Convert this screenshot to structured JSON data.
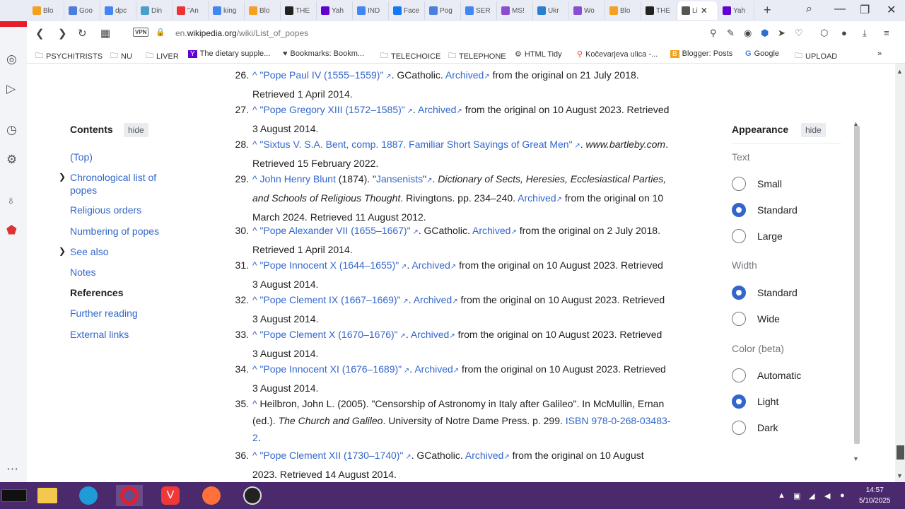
{
  "browser": {
    "tabs": [
      {
        "label": "Blo",
        "color": "#f4a020"
      },
      {
        "label": "Goo",
        "color": "#4a7fe0"
      },
      {
        "label": "dpc",
        "color": "#4285f4"
      },
      {
        "label": "Din",
        "color": "#4a9fd0"
      },
      {
        "label": "\"An",
        "color": "#e33"
      },
      {
        "label": "king",
        "color": "#4285f4"
      },
      {
        "label": "Blo",
        "color": "#f4a020"
      },
      {
        "label": "THE",
        "color": "#222"
      },
      {
        "label": "Yah",
        "color": "#6001d2"
      },
      {
        "label": "IND",
        "color": "#4285f4"
      },
      {
        "label": "Face",
        "color": "#1877f2"
      },
      {
        "label": "Pog",
        "color": "#4a7fe0"
      },
      {
        "label": "SER",
        "color": "#4285f4"
      },
      {
        "label": "MS!",
        "color": "#8a4fd0"
      },
      {
        "label": "Ukr",
        "color": "#2a7fd0"
      },
      {
        "label": "Wo",
        "color": "#8a4fd0"
      },
      {
        "label": "Blo",
        "color": "#f4a020"
      },
      {
        "label": "THE",
        "color": "#222"
      },
      {
        "label": "Li",
        "color": "#555",
        "active": true
      },
      {
        "label": "Yah",
        "color": "#6001d2"
      }
    ],
    "url_prefix": "en.",
    "url_domain": "wikipedia.org",
    "url_path": "/wiki/List_of_popes",
    "vpn_label": "VPN",
    "bookmarks": [
      {
        "label": "PSYCHITRISTS",
        "icon": "folder-icon"
      },
      {
        "label": "NU",
        "icon": "folder-icon"
      },
      {
        "label": "LIVER",
        "icon": "folder-icon"
      },
      {
        "label": "The dietary supple...",
        "icon": "yahoo-icon"
      },
      {
        "label": "Bookmarks: Bookm...",
        "icon": "heart-icon"
      },
      {
        "label": "TELECHOICE",
        "icon": "folder-icon"
      },
      {
        "label": "TELEPHONE",
        "icon": "folder-icon"
      },
      {
        "label": "HTML Tidy",
        "icon": "html-tidy-icon"
      },
      {
        "label": "Kočevarjeva ulica -...",
        "icon": "map-pin-icon"
      },
      {
        "label": "Blogger: Posts",
        "icon": "blogger-icon"
      },
      {
        "label": "Google",
        "icon": "google-icon"
      },
      {
        "label": "UPLOAD",
        "icon": "folder-icon"
      }
    ]
  },
  "toc": {
    "title": "Contents",
    "hide": "hide",
    "items": [
      {
        "label": "(Top)"
      },
      {
        "label": "Chronological list of"
      },
      {
        "label": "popes"
      },
      {
        "label": "Religious orders"
      },
      {
        "label": "Numbering of popes"
      },
      {
        "label": "See also"
      },
      {
        "label": "Notes"
      },
      {
        "label": "References"
      },
      {
        "label": "Further reading"
      },
      {
        "label": "External links"
      }
    ]
  },
  "references": [
    {
      "num": "26.",
      "l1": [
        [
          "^ ",
          "c"
        ],
        [
          "\"Pope Paul IV (1555–1559)\"",
          "l"
        ],
        [
          " ↗",
          "e"
        ],
        [
          ". GCatholic. ",
          "t"
        ],
        [
          "Archived",
          "l"
        ],
        [
          "↗",
          "e"
        ],
        [
          " from the original on 21 July 2018.",
          "t"
        ]
      ],
      "l2": [
        [
          "Retrieved 1 April 2014.",
          "t"
        ]
      ]
    },
    {
      "num": "27.",
      "l1": [
        [
          "^ ",
          "c"
        ],
        [
          "\"Pope Gregory XIII (1572–1585)\"",
          "l"
        ],
        [
          " ↗",
          "e"
        ],
        [
          ". ",
          "t"
        ],
        [
          "Archived",
          "l"
        ],
        [
          "↗",
          "e"
        ],
        [
          " from the original on 10 August 2023. Retrieved",
          "t"
        ]
      ],
      "l2": [
        [
          "3 August 2014.",
          "t"
        ]
      ]
    },
    {
      "num": "28.",
      "l1": [
        [
          "^ ",
          "c"
        ],
        [
          "\"Sixtus V. S.A. Bent, comp. 1887. Familiar Short Sayings of Great Men\"",
          "l"
        ],
        [
          " ↗",
          "e"
        ],
        [
          ". ",
          "t"
        ],
        [
          "www.bartleby.com",
          "i"
        ],
        [
          ".",
          "t"
        ]
      ],
      "l2": [
        [
          "Retrieved 15 February 2022.",
          "t"
        ]
      ]
    },
    {
      "num": "29.",
      "l1": [
        [
          "^ ",
          "c"
        ],
        [
          "John Henry Blunt",
          "l"
        ],
        [
          " (1874). \"",
          "t"
        ],
        [
          "Jansenists",
          "l"
        ],
        [
          "\"",
          "t"
        ],
        [
          "↗",
          "e"
        ],
        [
          ". ",
          "t"
        ],
        [
          "Dictionary of Sects, Heresies, Ecclesiastical Parties,",
          "i"
        ]
      ],
      "l2": [
        [
          "and Schools of Religious Thought",
          "i"
        ],
        [
          ". Rivingtons. pp. 234–240. ",
          "t"
        ],
        [
          "Archived",
          "l"
        ],
        [
          "↗",
          "e"
        ],
        [
          " from the original on 10",
          "t"
        ]
      ],
      "l3": [
        [
          "March 2024. Retrieved 11 August 2012.",
          "t"
        ]
      ]
    },
    {
      "num": "30.",
      "l1": [
        [
          "^ ",
          "c"
        ],
        [
          "\"Pope Alexander VII (1655–1667)\"",
          "l"
        ],
        [
          " ↗",
          "e"
        ],
        [
          ". GCatholic. ",
          "t"
        ],
        [
          "Archived",
          "l"
        ],
        [
          "↗",
          "e"
        ],
        [
          " from the original on 2 July 2018.",
          "t"
        ]
      ],
      "l2": [
        [
          "Retrieved 1 April 2014.",
          "t"
        ]
      ]
    },
    {
      "num": "31.",
      "l1": [
        [
          "^ ",
          "c"
        ],
        [
          "\"Pope Innocent X (1644–1655)\"",
          "l"
        ],
        [
          " ↗",
          "e"
        ],
        [
          ". ",
          "t"
        ],
        [
          "Archived",
          "l"
        ],
        [
          "↗",
          "e"
        ],
        [
          " from the original on 10 August 2023. Retrieved",
          "t"
        ]
      ],
      "l2": [
        [
          "3 August 2014.",
          "t"
        ]
      ]
    },
    {
      "num": "32.",
      "l1": [
        [
          "^ ",
          "c"
        ],
        [
          "\"Pope Clement IX (1667–1669)\"",
          "l"
        ],
        [
          " ↗",
          "e"
        ],
        [
          ". ",
          "t"
        ],
        [
          "Archived",
          "l"
        ],
        [
          "↗",
          "e"
        ],
        [
          " from the original on 10 August 2023. Retrieved",
          "t"
        ]
      ],
      "l2": [
        [
          "3 August 2014.",
          "t"
        ]
      ]
    },
    {
      "num": "33.",
      "l1": [
        [
          "^ ",
          "c"
        ],
        [
          "\"Pope Clement X (1670–1676)\"",
          "l"
        ],
        [
          " ↗",
          "e"
        ],
        [
          ". ",
          "t"
        ],
        [
          "Archived",
          "l"
        ],
        [
          "↗",
          "e"
        ],
        [
          " from the original on 10 August 2023. Retrieved",
          "t"
        ]
      ],
      "l2": [
        [
          "3 August 2014.",
          "t"
        ]
      ]
    },
    {
      "num": "34.",
      "l1": [
        [
          "^ ",
          "c"
        ],
        [
          "\"Pope Innocent XI (1676–1689)\"",
          "l"
        ],
        [
          " ↗",
          "e"
        ],
        [
          ". ",
          "t"
        ],
        [
          "Archived",
          "l"
        ],
        [
          "↗",
          "e"
        ],
        [
          " from the original on 10 August 2023. Retrieved",
          "t"
        ]
      ],
      "l2": [
        [
          "3 August 2014.",
          "t"
        ]
      ]
    },
    {
      "num": "35.",
      "l1": [
        [
          "^ ",
          "c"
        ],
        [
          "Heilbron, John L. (2005). \"Censorship of Astronomy in Italy after Galileo\". In McMullin, Ernan",
          "t"
        ]
      ],
      "l2": [
        [
          "(ed.). ",
          "t"
        ],
        [
          "The Church and Galileo",
          "i"
        ],
        [
          ". University of Notre Dame Press. p. 299. ",
          "t"
        ],
        [
          "ISBN 978-0-268-03483-",
          "l"
        ]
      ],
      "l3": [
        [
          "2",
          "l"
        ],
        [
          ".",
          "t"
        ]
      ]
    },
    {
      "num": "36.",
      "l1": [
        [
          "^ ",
          "c"
        ],
        [
          "\"Pope Clement XII (1730–1740)\"",
          "l"
        ],
        [
          " ↗",
          "e"
        ],
        [
          ". GCatholic. ",
          "t"
        ],
        [
          "Archived",
          "l"
        ],
        [
          "↗",
          "e"
        ],
        [
          " from the original on 10 August",
          "t"
        ]
      ],
      "l2": [
        [
          "2023. Retrieved 14 August 2014.",
          "t"
        ]
      ]
    }
  ],
  "appearance": {
    "title": "Appearance",
    "hide": "hide",
    "text_label": "Text",
    "text_options": [
      {
        "label": "Small",
        "checked": false
      },
      {
        "label": "Standard",
        "checked": true
      },
      {
        "label": "Large",
        "checked": false
      }
    ],
    "width_label": "Width",
    "width_options": [
      {
        "label": "Standard",
        "checked": true
      },
      {
        "label": "Wide",
        "checked": false
      }
    ],
    "color_label": "Color (beta)",
    "color_options": [
      {
        "label": "Automatic",
        "checked": false
      },
      {
        "label": "Light",
        "checked": true
      },
      {
        "label": "Dark",
        "checked": false
      }
    ]
  },
  "taskbar": {
    "time": "14:57",
    "date": "5/10/2025"
  },
  "colors": {
    "link": "#3366cc",
    "opera_red": "#e41e2b",
    "taskbar": "#4a2a6c"
  }
}
